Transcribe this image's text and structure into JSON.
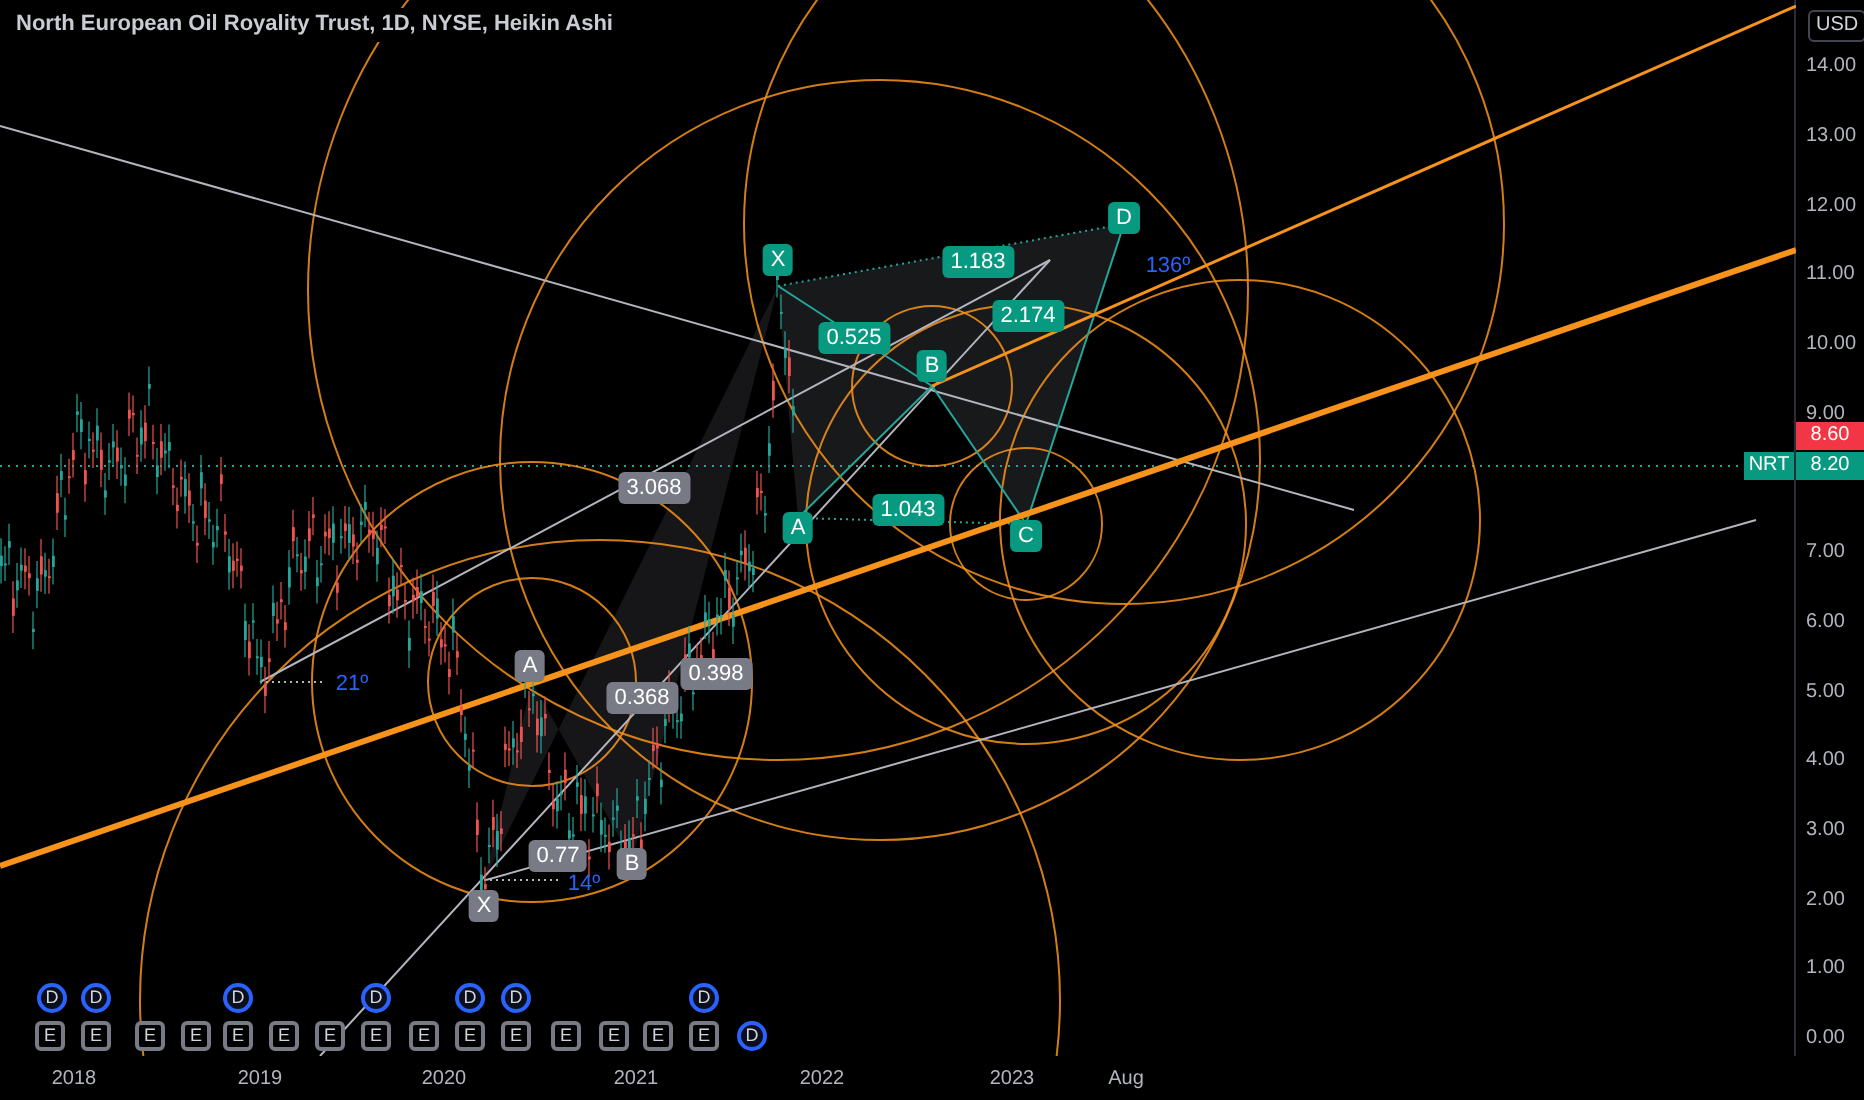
{
  "chart": {
    "title": "North European Oil Royality Trust, 1D, NYSE, Heikin Ashi",
    "pattern_labels": [
      {
        "text": "X",
        "color": "#787b86"
      },
      {
        "text": "A",
        "color": "#787b86"
      },
      {
        "text": "B",
        "color": "#787b86"
      },
      {
        "text": "0.77",
        "color": "#787b86"
      },
      {
        "text": "0.368",
        "color": "#787b86"
      },
      {
        "text": "0.398",
        "color": "#787b86"
      },
      {
        "text": "3.068",
        "color": "#787b86"
      },
      {
        "text": "X",
        "color": "#089981"
      },
      {
        "text": "A",
        "color": "#089981"
      },
      {
        "text": "B",
        "color": "#089981"
      },
      {
        "text": "C",
        "color": "#089981"
      },
      {
        "text": "D",
        "color": "#089981"
      },
      {
        "text": "1.183",
        "color": "#089981"
      },
      {
        "text": "0.525",
        "color": "#089981"
      },
      {
        "text": "2.174",
        "color": "#089981"
      },
      {
        "text": "1.043",
        "color": "#089981"
      }
    ],
    "angle_labels": [
      "21º",
      "14º",
      "136º"
    ],
    "events": [
      {
        "kind": "dividend",
        "label": "D"
      },
      {
        "kind": "dividend",
        "label": "D"
      },
      {
        "kind": "dividend",
        "label": "D"
      },
      {
        "kind": "dividend",
        "label": "D"
      },
      {
        "kind": "dividend",
        "label": "D"
      },
      {
        "kind": "dividend",
        "label": "D"
      },
      {
        "kind": "dividend",
        "label": "D"
      },
      {
        "kind": "earnings",
        "label": "E"
      },
      {
        "kind": "earnings",
        "label": "E"
      },
      {
        "kind": "earnings",
        "label": "E"
      },
      {
        "kind": "earnings",
        "label": "E"
      },
      {
        "kind": "earnings",
        "label": "E"
      },
      {
        "kind": "earnings",
        "label": "E"
      },
      {
        "kind": "earnings",
        "label": "E"
      },
      {
        "kind": "earnings",
        "label": "E"
      },
      {
        "kind": "earnings",
        "label": "E"
      },
      {
        "kind": "earnings",
        "label": "E"
      },
      {
        "kind": "earnings",
        "label": "E"
      },
      {
        "kind": "earnings",
        "label": "E"
      },
      {
        "kind": "earnings",
        "label": "E"
      },
      {
        "kind": "earnings",
        "label": "E"
      },
      {
        "kind": "earnings",
        "label": "E"
      },
      {
        "kind": "dividend",
        "label": "D"
      }
    ]
  },
  "price_axis": {
    "currency": "USD",
    "ticks": [
      "14.00",
      "13.00",
      "12.00",
      "11.00",
      "10.00",
      "9.00",
      "7.00",
      "6.00",
      "5.00",
      "4.00",
      "3.00",
      "2.00",
      "1.00",
      "0.00"
    ],
    "tags": [
      {
        "kind": "previous",
        "price": "8.60"
      },
      {
        "kind": "last",
        "symbol": "NRT",
        "price": "8.20"
      }
    ]
  },
  "time_axis": {
    "labels": [
      "2018",
      "2019",
      "2020",
      "2021",
      "2022",
      "2023",
      "Aug"
    ]
  }
}
